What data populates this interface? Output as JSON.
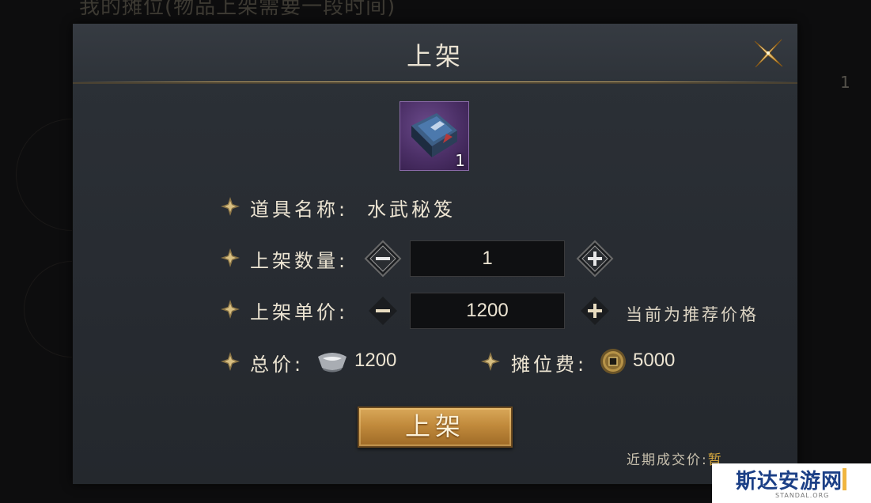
{
  "background": {
    "title": "我的摊位(物品上架需要一段时间)",
    "count": "1"
  },
  "dialog": {
    "title": "上架",
    "close_icon": "close-x-icon"
  },
  "item": {
    "icon": "book-icon",
    "quantity": "1"
  },
  "fields": {
    "name_label": "道具名称:",
    "name_value": "水武秘笈",
    "quantity_label": "上架数量:",
    "quantity_value": "1",
    "price_label": "上架单价:",
    "price_value": "1200",
    "price_hint": "当前为推荐价格",
    "total_label": "总价:",
    "total_value": "1200",
    "total_icon": "silver-ingot-icon",
    "fee_label": "摊位费:",
    "fee_value": "5000",
    "fee_icon": "copper-coin-icon"
  },
  "actions": {
    "confirm_label": "上架",
    "decrement_icon": "minus-icon",
    "increment_icon": "plus-icon"
  },
  "footer": {
    "recent_label": "近期成交价:",
    "recent_value": "暂"
  },
  "watermark": {
    "text": "斯达安游网",
    "sub": "STANDAL.ORG"
  },
  "colors": {
    "accent_gold": "#d9bc7a",
    "button_gold": "#c18a3c",
    "panel_bg": "#2a2e34"
  }
}
